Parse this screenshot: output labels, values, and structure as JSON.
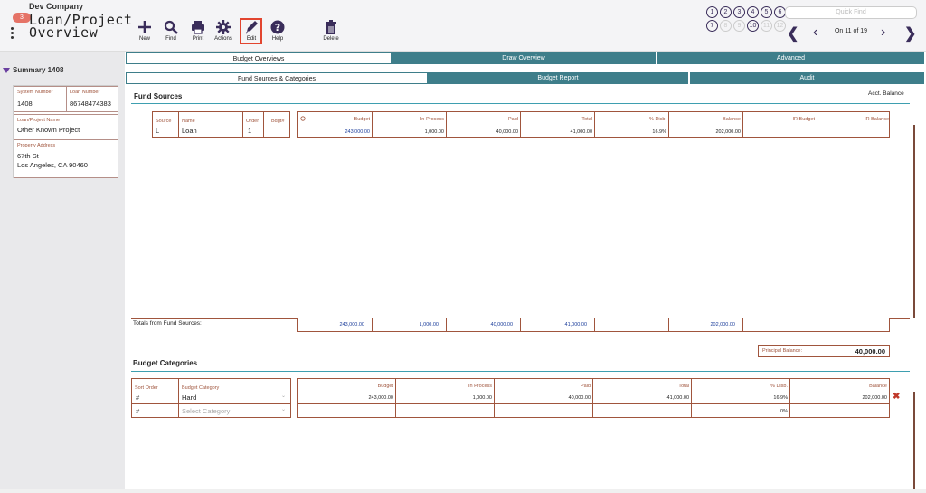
{
  "header": {
    "company": "Dev Company",
    "badge": "3",
    "title_line1": "Loan/Project",
    "title_line2": "Overview"
  },
  "toolbar": {
    "new": "New",
    "find": "Find",
    "print": "Print",
    "actions": "Actions",
    "edit": "Edit",
    "help": "Help",
    "delete": "Delete"
  },
  "quicknav": {
    "circles": [
      "1",
      "2",
      "3",
      "4",
      "5",
      "6",
      "7",
      "8",
      "9",
      "10",
      "11",
      "12"
    ],
    "quick_find_placeholder": "Quick Find",
    "record_pos": "On 11 of 19"
  },
  "sidebar": {
    "summary_title": "Summary 1408",
    "system_number_label": "System Number",
    "system_number": "1408",
    "loan_number_label": "Loan Number",
    "loan_number": "86748474383",
    "project_name_label": "Loan/Project Name",
    "project_name": "Other Known Project",
    "address_label": "Property Address",
    "address_line1": "67th St",
    "address_line2": "Los Angeles, CA  90460"
  },
  "tabs_top": [
    "Budget Overviews",
    "Draw Overview",
    "Advanced"
  ],
  "tabs_sub": [
    "Fund Sources & Categories",
    "Budget Report",
    "Audit"
  ],
  "fund_sources": {
    "title": "Fund Sources",
    "acct_balance": "Acct. Balance",
    "left_headers": [
      "Source",
      "Name",
      "Order",
      "Bdgt#"
    ],
    "left_row": [
      "L",
      "Loan",
      "1",
      ""
    ],
    "right_headers": [
      "Budget",
      "In-Process",
      "Paid",
      "Total",
      "% Disb.",
      "Balance",
      "IR Budget",
      "IR Balance"
    ],
    "right_row": [
      "243,000.00",
      "1,000.00",
      "40,000.00",
      "41,000.00",
      "16.9%",
      "202,000.00",
      "",
      ""
    ],
    "totals_label": "Totals from Fund Sources:",
    "totals": [
      "243,000.00",
      "1,000.00",
      "40,000.00",
      "41,000.00",
      "",
      "202,000.00",
      "",
      ""
    ],
    "principal_label": "Principal Balance:",
    "principal_value": "40,000.00"
  },
  "budget_categories": {
    "title": "Budget Categories",
    "left_headers": [
      "Sort Order",
      "Budget Category"
    ],
    "row1": [
      "#",
      "Hard"
    ],
    "row2_sort": "#",
    "row2_placeholder": "Select Category",
    "right_headers": [
      "Budget",
      "In Process",
      "Paid",
      "Total",
      "% Disb.",
      "Balance"
    ],
    "right_row1": [
      "243,000.00",
      "1,000.00",
      "40,000.00",
      "41,000.00",
      "16.9%",
      "202,000.00"
    ],
    "right_row2": [
      "",
      "",
      "",
      "",
      "0%",
      ""
    ]
  },
  "colors": {
    "tab_teal": "#3e7e8a",
    "label_brown": "#a0553d",
    "link_blue": "#1a3c9a",
    "accent_purple": "#3a2d5a",
    "edit_highlight": "#e2452f"
  }
}
